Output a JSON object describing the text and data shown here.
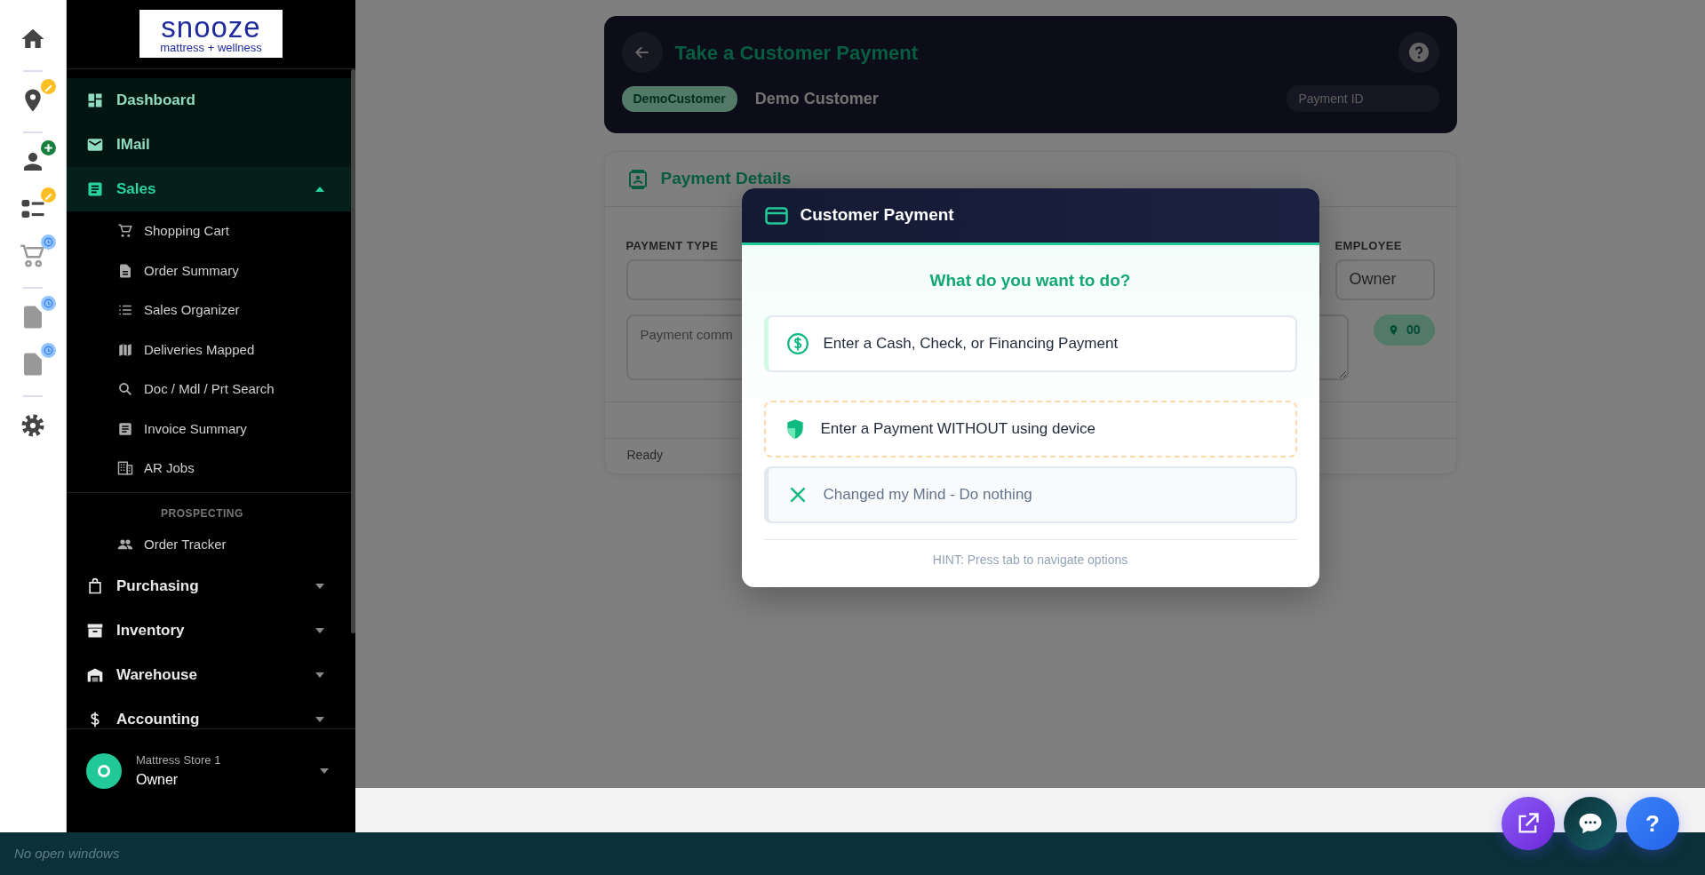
{
  "logo": {
    "name": "snooze",
    "tagline": "mattress + wellness"
  },
  "sidebar": {
    "items": [
      {
        "kind": "link",
        "label": "Dashboard",
        "highlighted": true,
        "selected": false
      },
      {
        "kind": "link",
        "label": "IMail",
        "highlighted": true,
        "selected": false
      },
      {
        "kind": "group",
        "label": "Sales",
        "highlighted": true,
        "selected": true,
        "expanded": true,
        "children": [
          {
            "label": "Shopping Cart"
          },
          {
            "label": "Order Summary"
          },
          {
            "label": "Sales Organizer"
          },
          {
            "label": "Deliveries Mapped"
          },
          {
            "label": "Doc / Mdl / Prt Search"
          },
          {
            "label": "Invoice Summary"
          },
          {
            "label": "AR Jobs"
          }
        ],
        "sections": [
          {
            "heading": "PROSPECTING",
            "children": [
              {
                "label": "Order Tracker"
              }
            ]
          }
        ]
      },
      {
        "kind": "group",
        "label": "Purchasing",
        "highlighted": false,
        "selected": false,
        "expanded": false
      },
      {
        "kind": "group",
        "label": "Inventory",
        "highlighted": false,
        "selected": false,
        "expanded": false
      },
      {
        "kind": "group",
        "label": "Warehouse",
        "highlighted": false,
        "selected": false,
        "expanded": false
      },
      {
        "kind": "group",
        "label": "Accounting",
        "highlighted": false,
        "selected": false,
        "expanded": false
      }
    ],
    "user": {
      "store": "Mattress Store 1",
      "role": "Owner"
    }
  },
  "header": {
    "title": "Take a Customer Payment",
    "customer_code": "DemoCustomer",
    "customer_name": "Demo Customer",
    "payment_id": {
      "placeholder": "Payment ID"
    }
  },
  "payment_details": {
    "title": "Payment Details",
    "fields": [
      {
        "label": "PAYMENT TYPE"
      },
      {
        "label": "EMPLOYEE",
        "value": "Owner"
      }
    ],
    "comments": {
      "placeholder": "Payment comm"
    },
    "location_badge": "00",
    "status": "Ready"
  },
  "modal": {
    "title": "Customer Payment",
    "question": "What do you want to do?",
    "options": [
      {
        "kind": "primary",
        "label": "Enter a Cash, Check, or Financing Payment"
      },
      {
        "kind": "manual",
        "label": "Enter a Payment WITHOUT using device"
      },
      {
        "kind": "cancel",
        "label": "Changed my Mind - Do nothing"
      }
    ],
    "hint": "HINT: Press tab to navigate options"
  },
  "help_button": {
    "label": "?"
  },
  "taskbar": {
    "text": "No open windows"
  }
}
